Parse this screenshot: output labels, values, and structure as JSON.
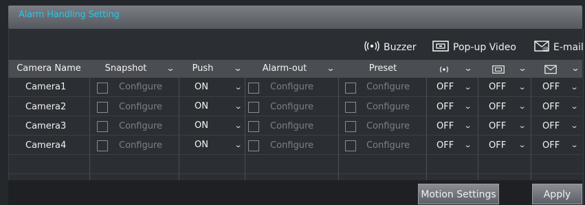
{
  "title": "Alarm Handling Setting",
  "legend": {
    "buzzer": "Buzzer",
    "popup_video": "Pop-up Video",
    "email": "E-mail"
  },
  "columns": {
    "camera_name": "Camera Name",
    "snapshot": "Snapshot",
    "push": "Push",
    "alarm_out": "Alarm-out",
    "preset": "Preset"
  },
  "rows": [
    {
      "camera": "Camera1",
      "snapshot_cfg": "Configure",
      "push": "ON",
      "alarm_cfg": "Configure",
      "preset_cfg": "Configure",
      "buzzer": "OFF",
      "popup": "OFF",
      "email": "OFF"
    },
    {
      "camera": "Camera2",
      "snapshot_cfg": "Configure",
      "push": "ON",
      "alarm_cfg": "Configure",
      "preset_cfg": "Configure",
      "buzzer": "OFF",
      "popup": "OFF",
      "email": "OFF"
    },
    {
      "camera": "Camera3",
      "snapshot_cfg": "Configure",
      "push": "ON",
      "alarm_cfg": "Configure",
      "preset_cfg": "Configure",
      "buzzer": "OFF",
      "popup": "OFF",
      "email": "OFF"
    },
    {
      "camera": "Camera4",
      "snapshot_cfg": "Configure",
      "push": "ON",
      "alarm_cfg": "Configure",
      "preset_cfg": "Configure",
      "buzzer": "OFF",
      "popup": "OFF",
      "email": "OFF"
    }
  ],
  "buttons": {
    "motion_settings": "Motion Settings",
    "apply": "Apply"
  },
  "colors": {
    "accent": "#29c6e6",
    "header": "#4a4d52",
    "panel": "#2b2e33"
  }
}
